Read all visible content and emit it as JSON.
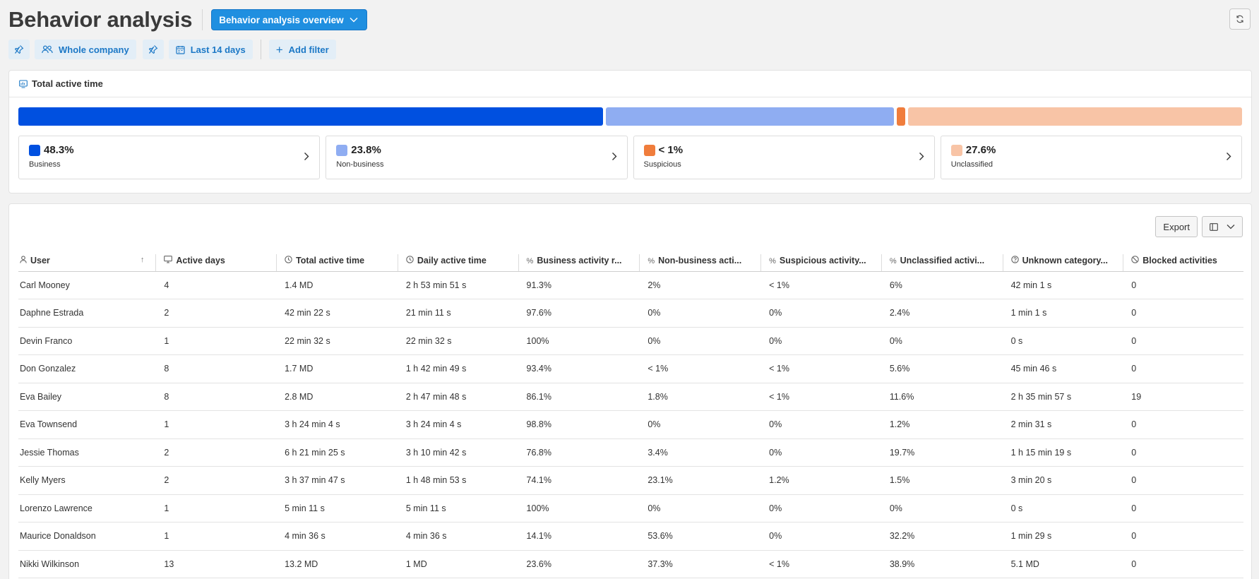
{
  "header": {
    "title": "Behavior analysis",
    "view_selector": "Behavior analysis overview"
  },
  "filters": {
    "scope": "Whole company",
    "period": "Last 14 days",
    "add_filter": "Add filter"
  },
  "summary": {
    "title": "Total active time",
    "segments": [
      {
        "label": "Business",
        "value": "48.3%",
        "share": 0.483,
        "color": "#0050e0"
      },
      {
        "label": "Non-business",
        "value": "23.8%",
        "share": 0.238,
        "color": "#8fadf2"
      },
      {
        "label": "Suspicious",
        "value": "< 1%",
        "share": 0.007,
        "color": "#f07d3c"
      },
      {
        "label": "Unclassified",
        "value": "27.6%",
        "share": 0.276,
        "color": "#f8c4a6"
      }
    ]
  },
  "table": {
    "export_label": "Export",
    "columns": [
      {
        "label": "User",
        "icon": "user-icon"
      },
      {
        "label": "Active days",
        "icon": "monitor-icon"
      },
      {
        "label": "Total active time",
        "icon": "clock-icon"
      },
      {
        "label": "Daily active time",
        "icon": "clock-icon"
      },
      {
        "label": "Business activity r...",
        "icon": "percent-icon"
      },
      {
        "label": "Non-business acti...",
        "icon": "percent-icon"
      },
      {
        "label": "Suspicious activity...",
        "icon": "percent-icon"
      },
      {
        "label": "Unclassified activi...",
        "icon": "percent-icon"
      },
      {
        "label": "Unknown category...",
        "icon": "question-icon"
      },
      {
        "label": "Blocked activities",
        "icon": "blocked-icon"
      }
    ],
    "rows": [
      [
        "Carl Mooney",
        "4",
        "1.4 MD",
        "2 h 53 min 51 s",
        "91.3%",
        "2%",
        "< 1%",
        "6%",
        "42 min 1 s",
        "0"
      ],
      [
        "Daphne Estrada",
        "2",
        "42 min 22 s",
        "21 min 11 s",
        "97.6%",
        "0%",
        "0%",
        "2.4%",
        "1 min 1 s",
        "0"
      ],
      [
        "Devin Franco",
        "1",
        "22 min 32 s",
        "22 min 32 s",
        "100%",
        "0%",
        "0%",
        "0%",
        "0 s",
        "0"
      ],
      [
        "Don Gonzalez",
        "8",
        "1.7 MD",
        "1 h 42 min 49 s",
        "93.4%",
        "< 1%",
        "< 1%",
        "5.6%",
        "45 min 46 s",
        "0"
      ],
      [
        "Eva Bailey",
        "8",
        "2.8 MD",
        "2 h 47 min 48 s",
        "86.1%",
        "1.8%",
        "< 1%",
        "11.6%",
        "2 h 35 min 57 s",
        "19"
      ],
      [
        "Eva Townsend",
        "1",
        "3 h 24 min 4 s",
        "3 h 24 min 4 s",
        "98.8%",
        "0%",
        "0%",
        "1.2%",
        "2 min 31 s",
        "0"
      ],
      [
        "Jessie Thomas",
        "2",
        "6 h 21 min 25 s",
        "3 h 10 min 42 s",
        "76.8%",
        "3.4%",
        "0%",
        "19.7%",
        "1 h 15 min 19 s",
        "0"
      ],
      [
        "Kelly Myers",
        "2",
        "3 h 37 min 47 s",
        "1 h 48 min 53 s",
        "74.1%",
        "23.1%",
        "1.2%",
        "1.5%",
        "3 min 20 s",
        "0"
      ],
      [
        "Lorenzo Lawrence",
        "1",
        "5 min 11 s",
        "5 min 11 s",
        "100%",
        "0%",
        "0%",
        "0%",
        "0 s",
        "0"
      ],
      [
        "Maurice Donaldson",
        "1",
        "4 min 36 s",
        "4 min 36 s",
        "14.1%",
        "53.6%",
        "0%",
        "32.2%",
        "1 min 29 s",
        "0"
      ],
      [
        "Nikki Wilkinson",
        "13",
        "13.2 MD",
        "1 MD",
        "23.6%",
        "37.3%",
        "< 1%",
        "38.9%",
        "5.1 MD",
        "0"
      ]
    ]
  }
}
